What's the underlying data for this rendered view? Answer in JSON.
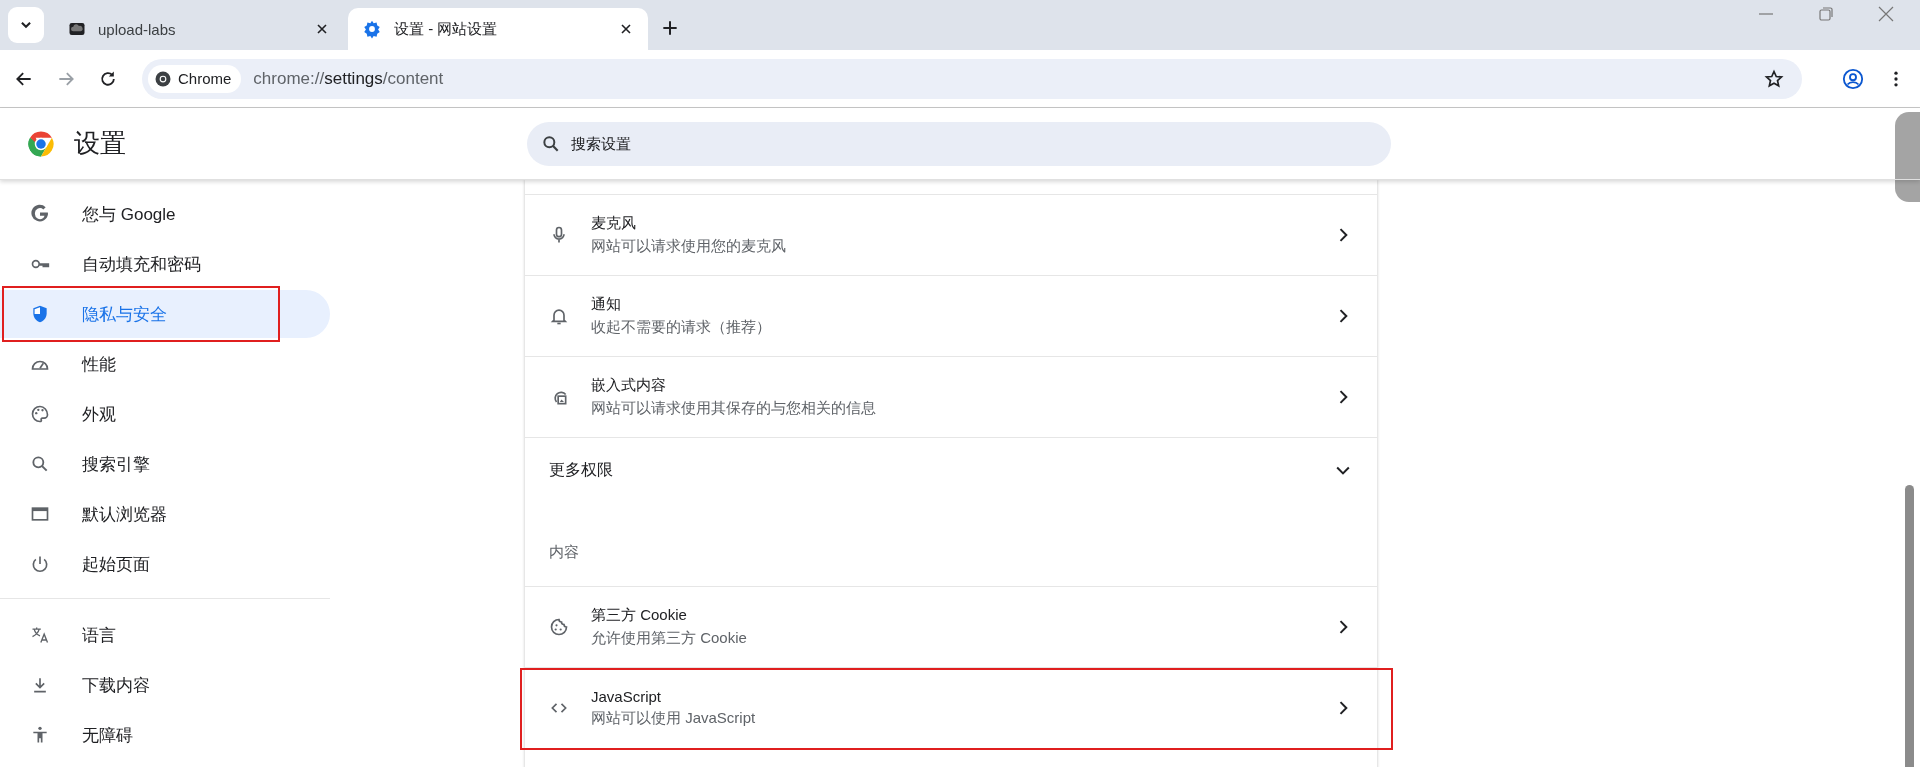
{
  "tab_strip": {
    "tabs": [
      {
        "title": "upload-labs",
        "selected": false
      },
      {
        "title": "设置 - 网站设置",
        "selected": true
      }
    ]
  },
  "toolbar": {
    "chip": "Chrome",
    "url_host": "chrome://",
    "url_path": "settings",
    "url_rest": "/content"
  },
  "header": {
    "title": "设置",
    "search": {
      "placeholder": "搜索设置"
    }
  },
  "sidebar": {
    "sections": [
      {
        "items": [
          {
            "label": "您与 Google",
            "selected": false,
            "highlighted": false
          },
          {
            "label": "自动填充和密码",
            "selected": false,
            "highlighted": false
          },
          {
            "label": "隐私与安全",
            "selected": true,
            "highlighted": true
          },
          {
            "label": "性能",
            "selected": false,
            "highlighted": false
          },
          {
            "label": "外观",
            "selected": false,
            "highlighted": false
          },
          {
            "label": "搜索引擎",
            "selected": false,
            "highlighted": false
          },
          {
            "label": "默认浏览器",
            "selected": false,
            "highlighted": false
          },
          {
            "label": "起始页面",
            "selected": false,
            "highlighted": false
          }
        ]
      },
      {
        "items": [
          {
            "label": "语言",
            "selected": false,
            "highlighted": false
          },
          {
            "label": "下载内容",
            "selected": false,
            "highlighted": false
          },
          {
            "label": "无障碍",
            "selected": false,
            "highlighted": false
          }
        ]
      }
    ]
  },
  "content": {
    "rows": [
      {
        "kind": "setting",
        "title": "麦克风",
        "subtitle": "网站可以请求使用您的麦克风",
        "highlighted": false
      },
      {
        "kind": "setting",
        "title": "通知",
        "subtitle": "收起不需要的请求（推荐）",
        "highlighted": false
      },
      {
        "kind": "setting",
        "title": "嵌入式内容",
        "subtitle": "网站可以请求使用其保存的与您相关的信息",
        "highlighted": false
      },
      {
        "kind": "expander",
        "title": "更多权限",
        "expanded": false
      },
      {
        "kind": "heading",
        "title": "内容"
      },
      {
        "kind": "setting",
        "title": "第三方 Cookie",
        "subtitle": "允许使用第三方 Cookie",
        "highlighted": false
      },
      {
        "kind": "setting",
        "title": "JavaScript",
        "subtitle": "网站可以使用 JavaScript",
        "highlighted": true
      }
    ]
  }
}
